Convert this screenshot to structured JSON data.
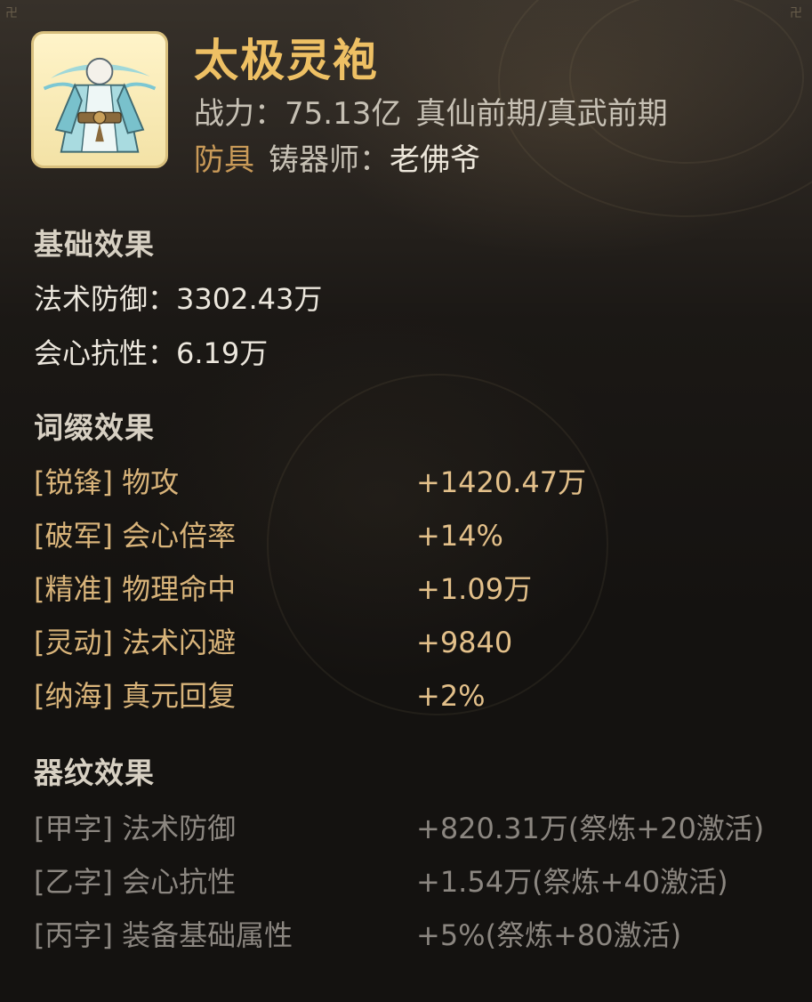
{
  "item": {
    "name": "太极灵袍",
    "power_label": "战力：",
    "power_value": "75.13亿",
    "realm": "真仙前期/真武前期",
    "type": "防具",
    "smith_label": "铸器师：",
    "smith_name": "老佛爷",
    "icon": "celestial-robe-icon"
  },
  "base": {
    "title": "基础效果",
    "stats": [
      {
        "label": "法术防御：",
        "value": "3302.43万"
      },
      {
        "label": "会心抗性：",
        "value": "6.19万"
      }
    ]
  },
  "affixes": {
    "title": "词缀效果",
    "rows": [
      {
        "name": "[锐锋] 物攻",
        "value": "+1420.47万"
      },
      {
        "name": "[破军] 会心倍率",
        "value": "+14%"
      },
      {
        "name": "[精准] 物理命中",
        "value": "+1.09万"
      },
      {
        "name": "[灵动] 法术闪避",
        "value": "+9840"
      },
      {
        "name": "[纳海] 真元回复",
        "value": "+2%"
      }
    ]
  },
  "runes": {
    "title": "器纹效果",
    "rows": [
      {
        "name": "[甲字] 法术防御",
        "value": "+820.31万(祭炼+20激活)"
      },
      {
        "name": "[乙字] 会心抗性",
        "value": "+1.54万(祭炼+40激活)"
      },
      {
        "name": "[丙字] 装备基础属性",
        "value": "+5%(祭炼+80激活)"
      }
    ]
  },
  "colors": {
    "title": "#eec064",
    "type": "#c99a58",
    "affix": "#d9b47a",
    "rune": "#8b8680"
  }
}
